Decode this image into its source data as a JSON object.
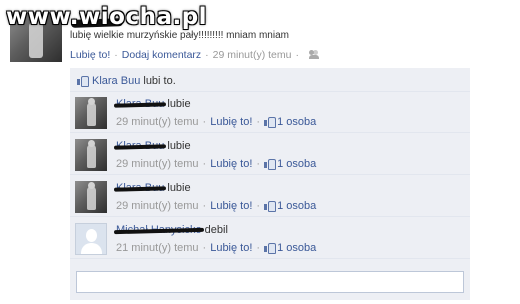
{
  "watermark": "www.wiocha.pl",
  "post": {
    "text": "lubię wielkie murzyńskie pały!!!!!!!!! mniam mniam",
    "meta": {
      "like_label": "Lubię to!",
      "comment_label": "Dodaj komentarz",
      "time": "29 minut(y) temu",
      "audience_icon": "friends-icon"
    }
  },
  "likes": {
    "name": "Klara Buu",
    "suffix": "lubi to."
  },
  "comments": [
    {
      "author": "Klara Buu",
      "text": "lubie",
      "time": "29 minut(y) temu",
      "like_label": "Lubię to!",
      "likes": "1 osoba"
    },
    {
      "author": "Klara Buu",
      "text": "lubie",
      "time": "29 minut(y) temu",
      "like_label": "Lubię to!",
      "likes": "1 osoba"
    },
    {
      "author": "Klara Buu",
      "text": "lubie",
      "time": "29 minut(y) temu",
      "like_label": "Lubię to!",
      "likes": "1 osoba"
    },
    {
      "author": "Michał Hanysicko",
      "text": "debil",
      "time": "21 minut(y) temu",
      "like_label": "Lubię to!",
      "likes": "1 osoba"
    }
  ],
  "colors": {
    "link": "#3b5998",
    "meta_gray": "#999999",
    "feed_background": "#edeff4"
  }
}
